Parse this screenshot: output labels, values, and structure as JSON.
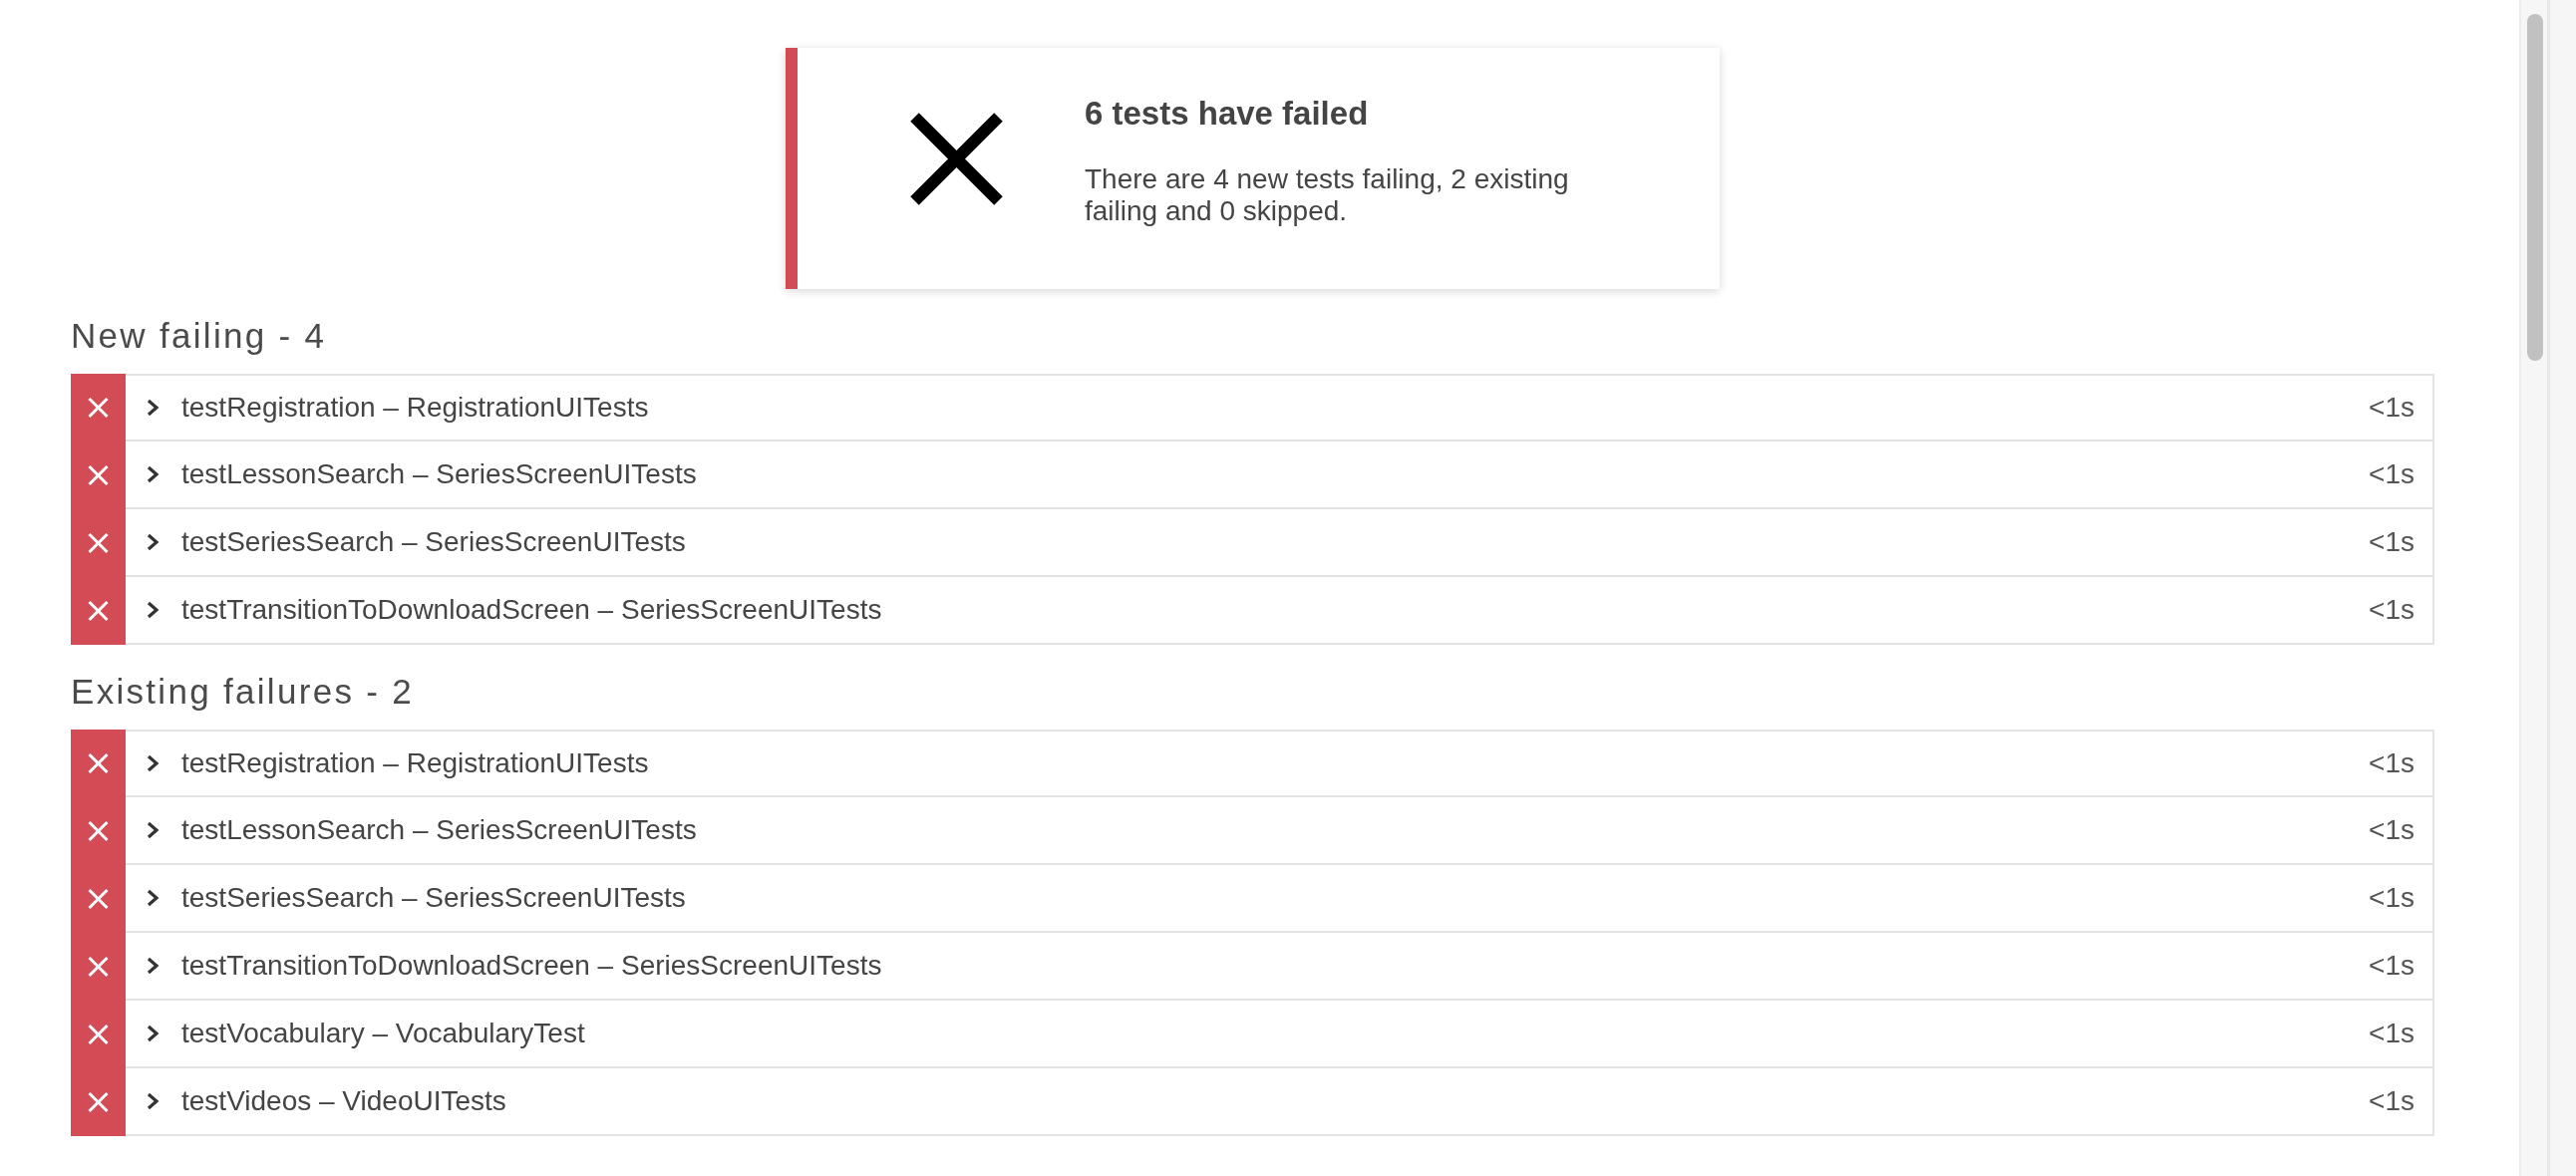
{
  "summary": {
    "failed": true,
    "title": "6 tests have failed",
    "description": "There are 4 new tests failing, 2 existing failing and 0 skipped."
  },
  "sections": [
    {
      "title": "New failing - 4",
      "tests": [
        {
          "failed": true,
          "expanded": false,
          "name": "testRegistration – RegistrationUITests",
          "duration": "<1s"
        },
        {
          "failed": true,
          "expanded": false,
          "name": "testLessonSearch – SeriesScreenUITests",
          "duration": "<1s"
        },
        {
          "failed": true,
          "expanded": false,
          "name": "testSeriesSearch – SeriesScreenUITests",
          "duration": "<1s"
        },
        {
          "failed": true,
          "expanded": false,
          "name": "testTransitionToDownloadScreen – SeriesScreenUITests",
          "duration": "<1s"
        }
      ]
    },
    {
      "title": "Existing failures - 2",
      "tests": [
        {
          "failed": true,
          "expanded": false,
          "name": "testRegistration – RegistrationUITests",
          "duration": "<1s"
        },
        {
          "failed": true,
          "expanded": false,
          "name": "testLessonSearch – SeriesScreenUITests",
          "duration": "<1s"
        },
        {
          "failed": true,
          "expanded": false,
          "name": "testSeriesSearch – SeriesScreenUITests",
          "duration": "<1s"
        },
        {
          "failed": true,
          "expanded": false,
          "name": "testTransitionToDownloadScreen – SeriesScreenUITests",
          "duration": "<1s"
        },
        {
          "failed": true,
          "expanded": false,
          "name": "testVocabulary – VocabularyTest",
          "duration": "<1s"
        },
        {
          "failed": true,
          "expanded": false,
          "name": "testVideos – VideoUITests",
          "duration": "<1s"
        }
      ]
    }
  ]
}
